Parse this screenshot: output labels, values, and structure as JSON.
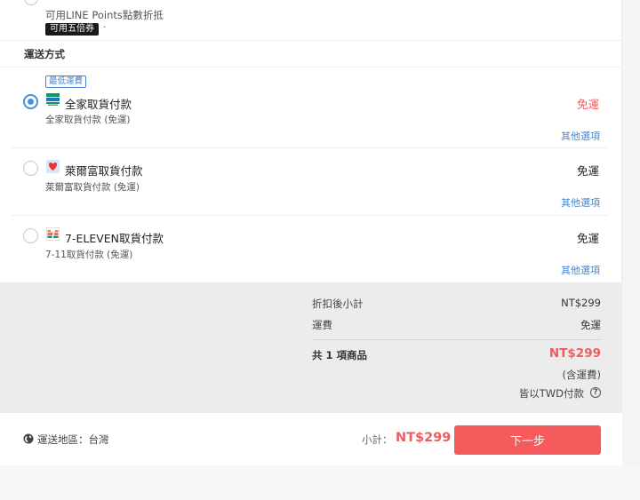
{
  "top": {
    "points_text": "可用LINE Points點數折抵",
    "voucher_badge": "可用五倍券",
    "voucher_dot": "·"
  },
  "shipping": {
    "title": "運送方式",
    "options": [
      {
        "badge": "最低運費",
        "name": "全家取貨付款",
        "sub": "全家取貨付款 (免運)",
        "fee": "免運",
        "more": "其他選項",
        "selected": true,
        "logo": "familymart-logo"
      },
      {
        "name": "萊爾富取貨付款",
        "sub": "萊爾富取貨付款 (免運)",
        "fee": "免運",
        "more": "其他選項",
        "selected": false,
        "logo": "hilife-logo"
      },
      {
        "name": "7-ELEVEN取貨付款",
        "sub": "7-11取貨付款 (免運)",
        "fee": "免運",
        "more": "其他選項",
        "selected": false,
        "logo": "seven-eleven-logo"
      }
    ]
  },
  "summary": {
    "discount_subtotal_label": "折扣後小計",
    "discount_subtotal_value": "NT$299",
    "shipping_fee_label": "運費",
    "shipping_fee_value": "免運",
    "items_label": "共 1 項商品",
    "total_value": "NT$299",
    "incl_shipping": "(含運費)",
    "currency_note": "皆以TWD付款",
    "help_icon": "?"
  },
  "footer": {
    "region": "運送地區：台灣",
    "subtotal_label": "小計：",
    "subtotal_value": "NT$299",
    "next_button": "下一步"
  },
  "colors": {
    "accent_red": "#f25c5c",
    "link_blue": "#4a86c8",
    "radio_blue": "#4a90d9"
  }
}
